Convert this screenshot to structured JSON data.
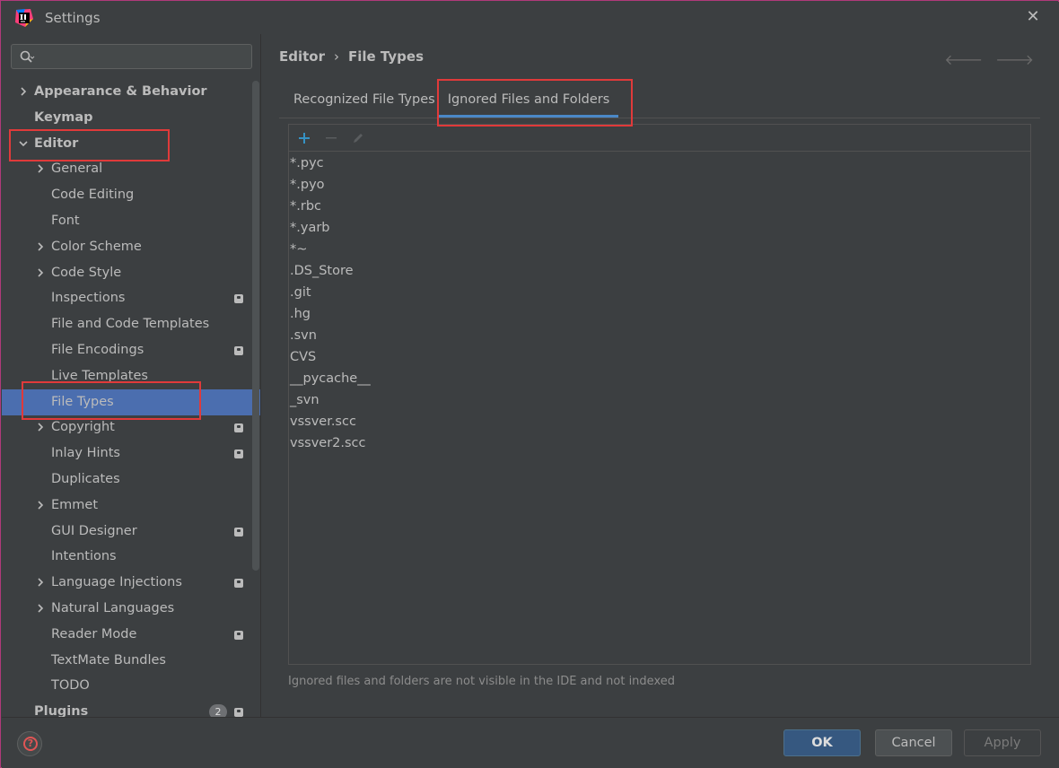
{
  "window": {
    "title": "Settings"
  },
  "search": {
    "placeholder": ""
  },
  "sidebar": {
    "items": [
      {
        "label": "Appearance & Behavior",
        "arrow": "right"
      },
      {
        "label": "Keymap"
      },
      {
        "label": "Editor",
        "arrow": "down"
      },
      {
        "label": "General",
        "arrow": "right"
      },
      {
        "label": "Code Editing"
      },
      {
        "label": "Font"
      },
      {
        "label": "Color Scheme",
        "arrow": "right"
      },
      {
        "label": "Code Style",
        "arrow": "right"
      },
      {
        "label": "Inspections",
        "project_badge": true
      },
      {
        "label": "File and Code Templates"
      },
      {
        "label": "File Encodings",
        "project_badge": true
      },
      {
        "label": "Live Templates"
      },
      {
        "label": "File Types",
        "selected": true
      },
      {
        "label": "Copyright",
        "arrow": "right",
        "project_badge": true
      },
      {
        "label": "Inlay Hints",
        "project_badge": true
      },
      {
        "label": "Duplicates"
      },
      {
        "label": "Emmet",
        "arrow": "right"
      },
      {
        "label": "GUI Designer",
        "project_badge": true
      },
      {
        "label": "Intentions"
      },
      {
        "label": "Language Injections",
        "arrow": "right",
        "project_badge": true
      },
      {
        "label": "Natural Languages",
        "arrow": "right"
      },
      {
        "label": "Reader Mode",
        "project_badge": true
      },
      {
        "label": "TextMate Bundles"
      },
      {
        "label": "TODO"
      },
      {
        "label": "Plugins",
        "badge_count": "2",
        "project_badge": true
      }
    ]
  },
  "breadcrumb": {
    "parent": "Editor",
    "separator": "›",
    "current": "File Types"
  },
  "tabs": [
    {
      "label": "Recognized File Types"
    },
    {
      "label": "Ignored Files and Folders",
      "active": true
    }
  ],
  "ignored_list": [
    "*.pyc",
    "*.pyo",
    "*.rbc",
    "*.yarb",
    "*~",
    ".DS_Store",
    ".git",
    ".hg",
    ".svn",
    "CVS",
    "__pycache__",
    "_svn",
    "vssver.scc",
    "vssver2.scc"
  ],
  "hint": "Ignored files and folders are not visible in the IDE and not indexed",
  "footer": {
    "ok": "OK",
    "cancel": "Cancel",
    "apply": "Apply",
    "help": "?"
  },
  "colors": {
    "accent": "#4b6eaf",
    "highlight": "#e03a3a",
    "tab_underline": "#4a88c7"
  }
}
